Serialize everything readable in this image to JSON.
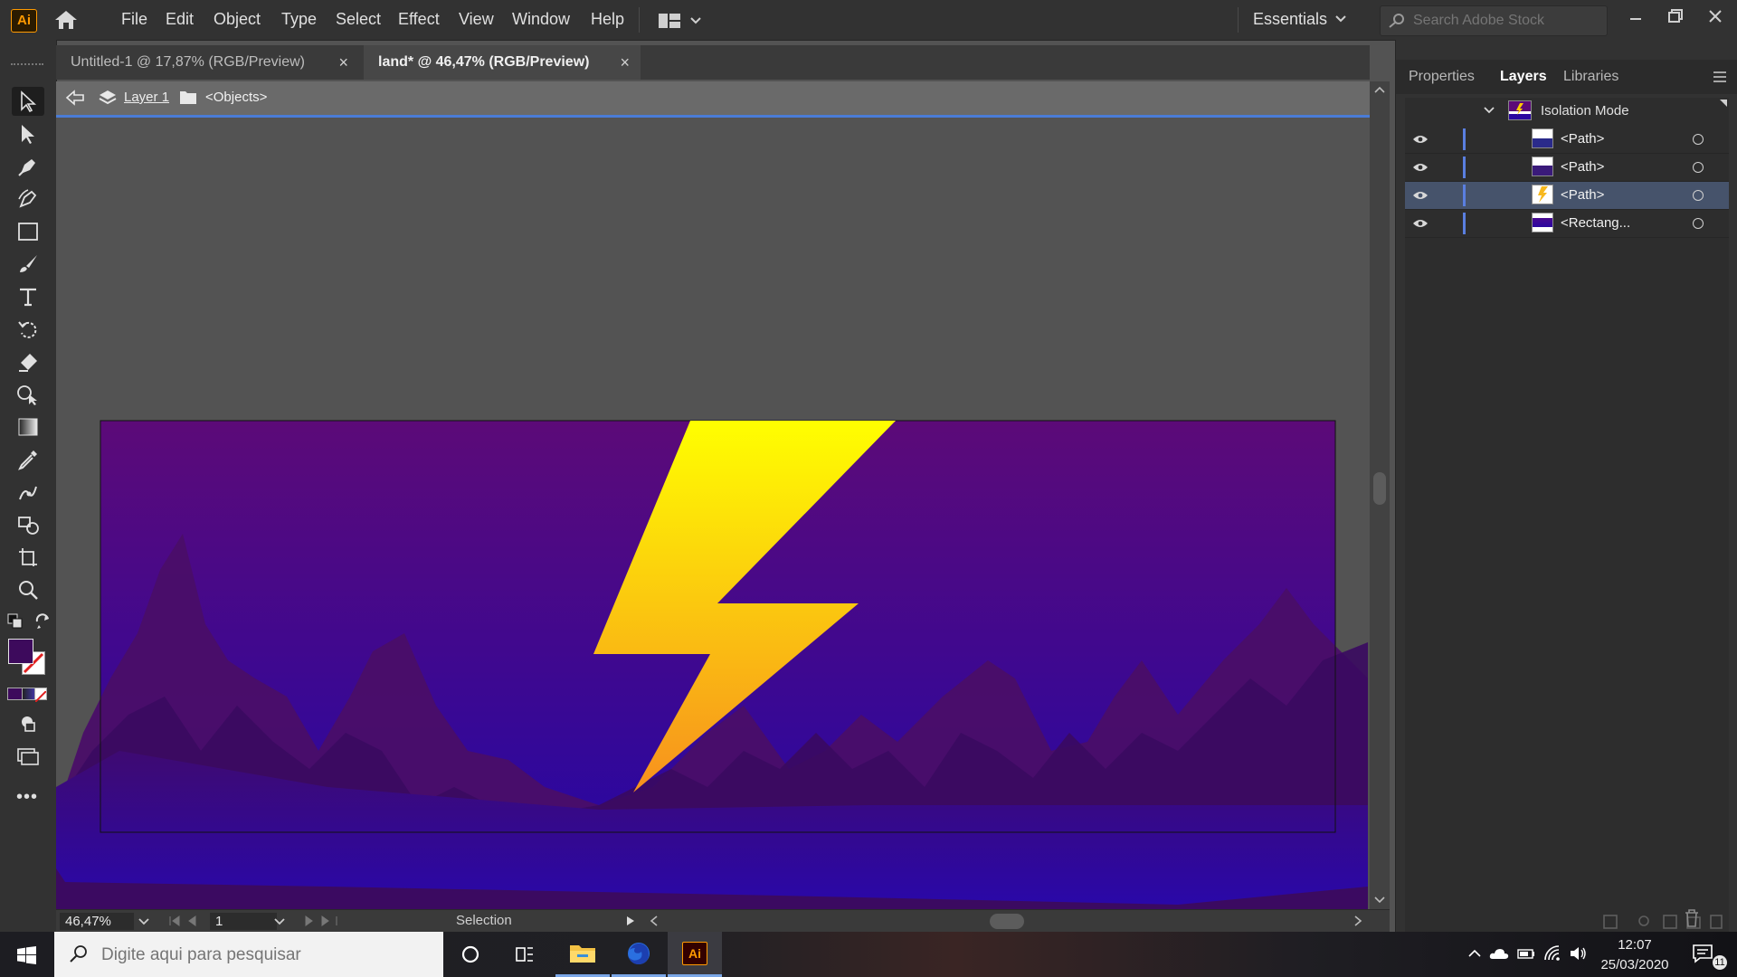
{
  "app": {
    "logo_text": "Ai"
  },
  "menu": {
    "items": [
      "File",
      "Edit",
      "Object",
      "Type",
      "Select",
      "Effect",
      "View",
      "Window",
      "Help"
    ],
    "workspace": "Essentials",
    "search_placeholder": "Search Adobe Stock"
  },
  "tabs": [
    {
      "label": "Untitled-1 @ 17,87% (RGB/Preview)",
      "close": "×"
    },
    {
      "label": "land* @ 46,47% (RGB/Preview)",
      "close": "×"
    }
  ],
  "isolation_bar": {
    "layer": "Layer 1",
    "objects": "<Objects>"
  },
  "status": {
    "zoom": "46,47%",
    "page": "1",
    "tool": "Selection"
  },
  "panel": {
    "tabs": [
      "Properties",
      "Layers",
      "Libraries"
    ],
    "active_tab": "Layers",
    "isolation_label": "Isolation Mode",
    "layers": [
      {
        "name": "<Path>",
        "thumb": "path-wave",
        "selected": false
      },
      {
        "name": "<Path>",
        "thumb": "path-wave",
        "selected": false
      },
      {
        "name": "<Path>",
        "thumb": "lightning-bolt",
        "selected": true
      },
      {
        "name": "<Rectang...",
        "thumb": "rectangle",
        "selected": false
      }
    ]
  },
  "colors": {
    "accent": "#4a7cd6",
    "fill_swatch": "#3d0a5c",
    "bg_top": "#5c0a78",
    "bg_bottom": "#2a07a0",
    "bolt_top": "#ffff00",
    "bolt_bottom": "#f7901e"
  },
  "taskbar": {
    "search_placeholder": "Digite aqui para pesquisar",
    "apps": [
      "cortana-icon",
      "task-view-icon",
      "file-explorer-icon",
      "firefox-icon",
      "illustrator-icon"
    ],
    "illustrator_label": "Ai",
    "time": "12:07",
    "date": "25/03/2020",
    "notifications": "11"
  }
}
